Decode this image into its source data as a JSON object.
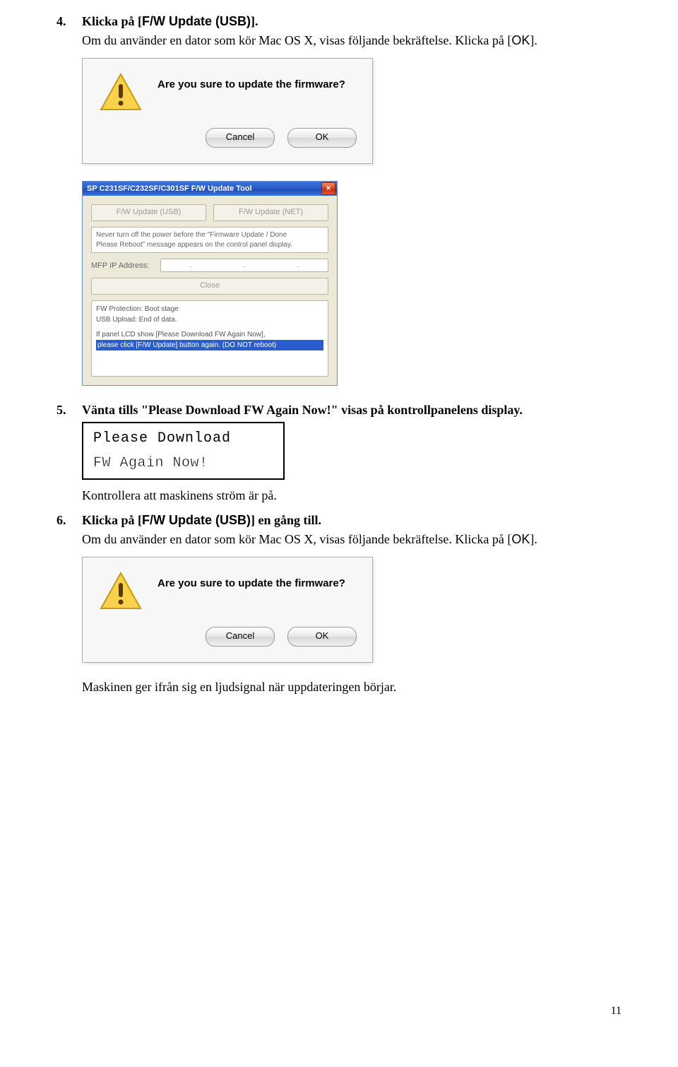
{
  "step4": {
    "num": "4.",
    "title_pre": "Klicka på [",
    "title_bold": "F/W Update (USB)",
    "title_post": "].",
    "body_pre": "Om du använder en dator som kör Mac OS X, visas följande bekräftelse. Klicka på [",
    "body_bold": "OK",
    "body_post": "]."
  },
  "mac_dialog": {
    "message": "Are you sure to update the firmware?",
    "cancel": "Cancel",
    "ok": "OK"
  },
  "win_tool": {
    "title": "SP C231SF/C232SF/C301SF F/W Update Tool",
    "btn_usb": "F/W Update (USB)",
    "btn_net": "F/W Update (NET)",
    "msg_line1": "Never turn off the power before the \"Firmware Update / Done",
    "msg_line2": "Please Reboot\" message appears on the control panel display.",
    "ip_label": "MFP IP Address:",
    "close": "Close",
    "log_l1": "FW Protection: Boot stage",
    "log_l2": "USB Upload: End of data.",
    "log_l3": "If panel LCD show [Please Download FW Again Now],",
    "log_l4": "please click [F/W Update] button again. (DO NOT reboot)"
  },
  "step5": {
    "num": "5.",
    "title": "Vänta tills \"Please Download FW Again Now!\" visas på kontrollpanelens display."
  },
  "lcd": {
    "line1": "Please Download",
    "line2": "FW Again Now!"
  },
  "step5_sub": "Kontrollera att maskinens ström är på.",
  "step6": {
    "num": "6.",
    "title_pre": "Klicka på [",
    "title_bold": "F/W Update (USB)",
    "title_post": "] en gång till.",
    "body_pre": "Om du använder en dator som kör Mac OS X, visas följande bekräftelse. Klicka på [",
    "body_bold": "OK",
    "body_post": "]."
  },
  "after6": "Maskinen ger ifrån sig en ljudsignal när uppdateringen börjar.",
  "page_num": "11"
}
